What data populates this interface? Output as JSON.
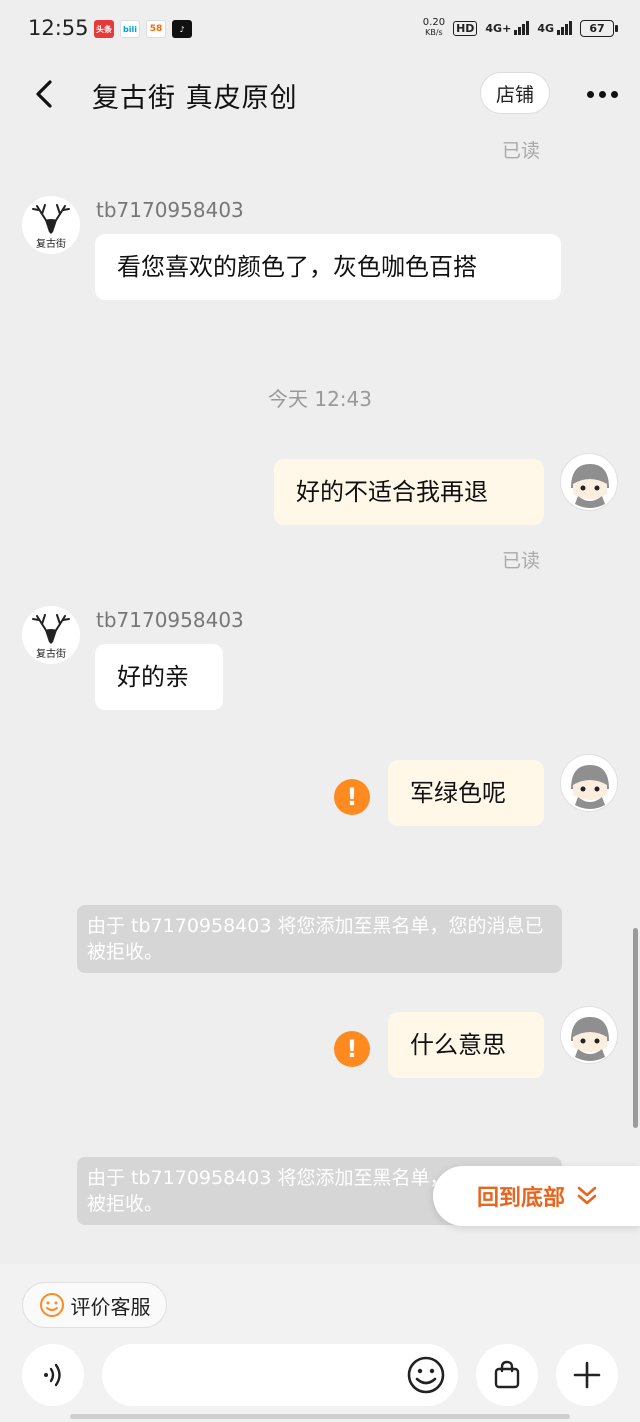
{
  "status_bar": {
    "time": "12:55",
    "apps": [
      "头条",
      "bili",
      "58",
      "♪"
    ],
    "net_speed_value": "0.20",
    "net_speed_unit": "KB/s",
    "hd": "HD",
    "signal1": "4G+",
    "signal2": "4G",
    "battery": "67"
  },
  "header": {
    "title": "复古街 真皮原创",
    "shop_button": "店铺"
  },
  "chat": {
    "top_read": "已读",
    "sender_name": "tb7170958403",
    "shop_logo_text": "复古街",
    "msg1": "看您喜欢的颜色了，灰色咖色百搭",
    "time_sep": "今天 12:43",
    "msg2": "好的不适合我再退",
    "read2": "已读",
    "msg3": "好的亲",
    "msg4": "军绿色呢",
    "sys1": "由于 tb7170958403 将您添加至黑名单，您的消息已被拒收。",
    "msg5": "什么意思",
    "sys2": "由于 tb7170958403 将您添加至黑名单，您的消息已被拒收。",
    "warn_glyph": "!"
  },
  "back_to_bottom": "回到底部",
  "bottom_bar": {
    "rate_label": "评价客服",
    "input_placeholder": ""
  },
  "colors": {
    "accent_orange": "#ff8a1f",
    "back_bottom_text": "#e8651f",
    "out_bubble": "#fff8e9",
    "in_bubble": "#ffffff"
  }
}
